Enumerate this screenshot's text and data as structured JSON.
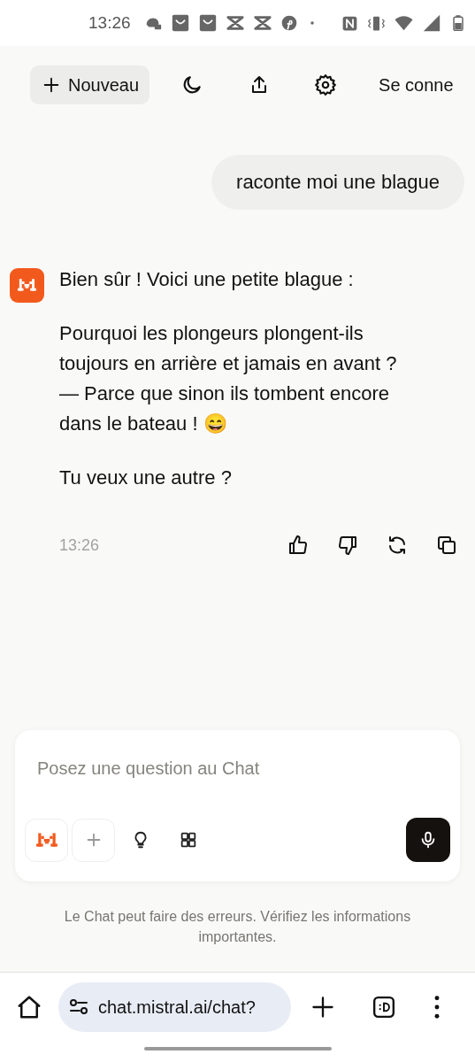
{
  "status_bar": {
    "time": "13:26"
  },
  "header": {
    "new_button": "Nouveau",
    "sign_in": "Se conne"
  },
  "messages": [
    {
      "kind": "user",
      "text": "raconte moi une blague"
    },
    {
      "kind": "assistant",
      "paragraphs": [
        "Bien sûr ! Voici une petite blague :",
        "Pourquoi les plongeurs plongent-ils toujours en arrière et jamais en avant ?\n— Parce que sinon ils tombent encore dans le bateau ! 😄",
        "Tu veux une autre ?"
      ],
      "time": "13:26"
    }
  ],
  "composer": {
    "placeholder": "Posez une question au Chat"
  },
  "disclaimer": "Le Chat peut faire des erreurs. Vérifiez les informations importantes.",
  "browser": {
    "url": "chat.mistral.ai/chat?"
  }
}
